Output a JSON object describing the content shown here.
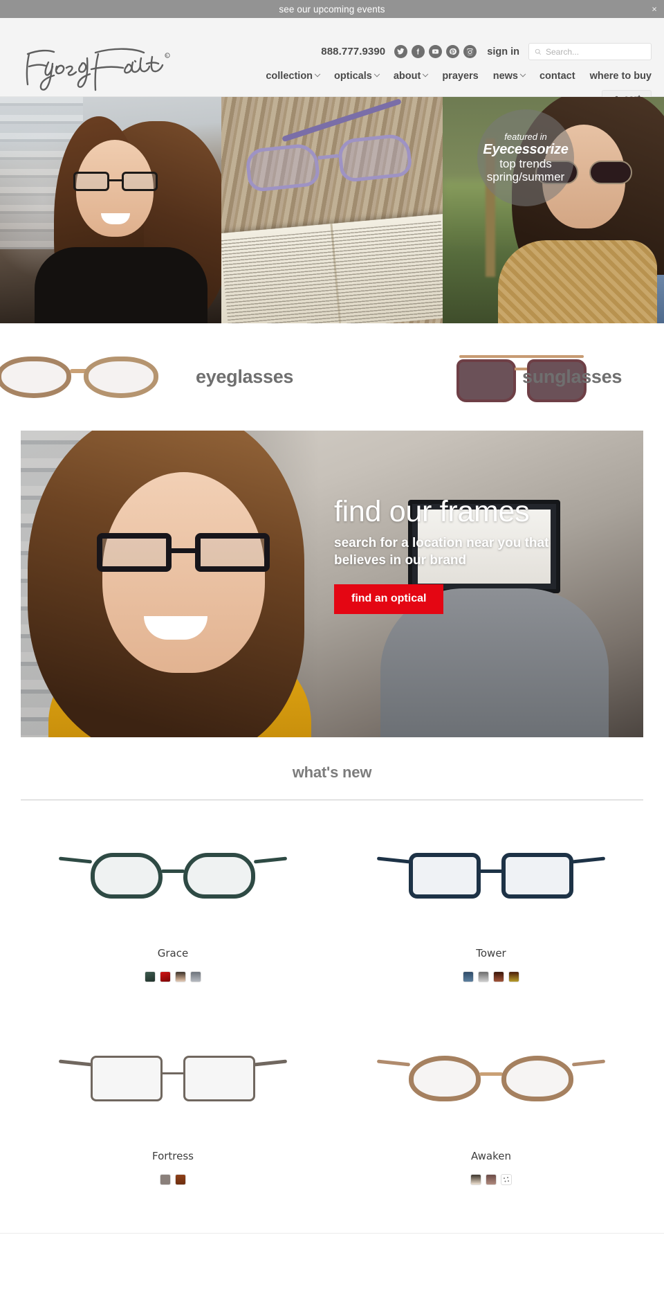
{
  "announcement": {
    "text": "see our upcoming events",
    "close_label": "×"
  },
  "header": {
    "logo_text": "Eyes of Faith",
    "phone": "888.777.9390",
    "sign_in": "sign in",
    "search": {
      "placeholder": "Search...",
      "value": "",
      "icon": "search-icon"
    },
    "cart": {
      "label": "cart",
      "icon": "basket-icon"
    },
    "socials": [
      {
        "name": "twitter-icon",
        "label": "Twitter"
      },
      {
        "name": "facebook-icon",
        "label": "Facebook"
      },
      {
        "name": "youtube-icon",
        "label": "YouTube"
      },
      {
        "name": "pinterest-icon",
        "label": "Pinterest"
      },
      {
        "name": "instagram-icon",
        "label": "Instagram"
      }
    ],
    "nav": [
      {
        "label": "collection",
        "has_dropdown": true
      },
      {
        "label": "opticals",
        "has_dropdown": true
      },
      {
        "label": "about",
        "has_dropdown": true
      },
      {
        "label": "prayers",
        "has_dropdown": false
      },
      {
        "label": "news",
        "has_dropdown": true
      },
      {
        "label": "contact",
        "has_dropdown": false
      },
      {
        "label": "where to buy",
        "has_dropdown": false
      }
    ]
  },
  "hero_collage": {
    "badge": {
      "line1": "featured in",
      "line2": "Eyecessorize",
      "line3": "top trends",
      "line4": "spring/summer"
    }
  },
  "categories": [
    {
      "label": "eyeglasses",
      "art": "eyeglasses-frame-art"
    },
    {
      "label": "sunglasses",
      "art": "sunglasses-frame-art"
    }
  ],
  "find_frames": {
    "title": "find our frames",
    "subtitle": "search for a location near you that believes in our brand",
    "button": "find an optical",
    "button_color": "#e40613"
  },
  "whats_new": {
    "heading": "what's new",
    "products": [
      {
        "name": "Grace",
        "frame_color": "#2e4a44",
        "lens_color": "rgba(190,205,205,0.3)",
        "swatches": [
          "#33483f",
          "#b60d0d",
          "#8d7566",
          "#8d929a"
        ]
      },
      {
        "name": "Tower",
        "frame_color": "#1d3246",
        "lens_color": "rgba(190,205,215,0.3)",
        "swatches": [
          "#3f5c79",
          "#9a9a9a",
          "#6e3424",
          "#8c7325"
        ]
      },
      {
        "name": "Fortress",
        "frame_color": "#70675f",
        "lens_color": "rgba(205,205,205,0.25)",
        "swatches": [
          "#8a807b",
          "#8d3f18"
        ]
      },
      {
        "name": "Awaken",
        "frame_color": "#b08b6d",
        "lens_color": "rgba(215,205,200,0.25)",
        "swatches": [
          "#7e6b59",
          "#8b5f57",
          "more-colors"
        ]
      }
    ]
  }
}
